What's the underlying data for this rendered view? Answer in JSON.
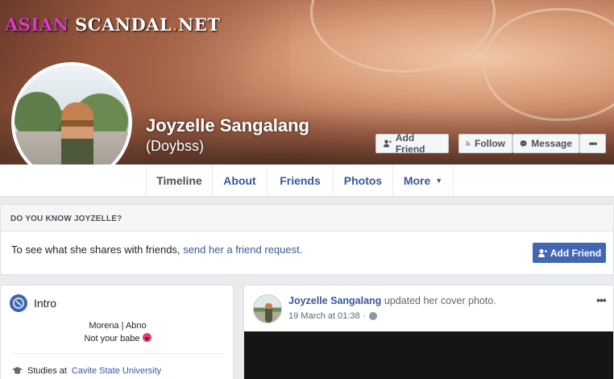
{
  "watermark": {
    "part1": "ASIAN",
    "part2": "SCANDAL",
    "dot": ".",
    "part3": "NET"
  },
  "profile": {
    "name": "Joyzelle Sangalang",
    "nickname": "(Doybss)"
  },
  "cover_actions": {
    "add_friend": "Add Friend",
    "follow": "Follow",
    "message": "Message",
    "more": "•••"
  },
  "tabs": [
    {
      "label": "Timeline",
      "active": true
    },
    {
      "label": "About"
    },
    {
      "label": "Friends"
    },
    {
      "label": "Photos"
    },
    {
      "label": "More"
    }
  ],
  "know_box": {
    "heading": "DO YOU KNOW JOYZELLE?",
    "text": "To see what she shares with friends,",
    "link": "send her a friend request.",
    "button": "Add Friend"
  },
  "intro": {
    "title": "Intro",
    "bio_line1": "Morena | Abno",
    "bio_line2": "Not your babe",
    "studies_prefix": "Studies at",
    "school": "Cavite State University"
  },
  "post": {
    "author": "Joyzelle Sangalang",
    "action": "updated her cover photo.",
    "time": "19 March at 01:38",
    "menu": "•••"
  },
  "icons": [
    "add-friend-icon",
    "rss-icon",
    "messenger-icon",
    "globe-icon",
    "graduation-cap-icon",
    "privacy-globe-icon",
    "tongue-emoji-icon"
  ],
  "colors": {
    "link": "#365899",
    "primary_button": "#4267b2",
    "page_background": "#e9ebee"
  }
}
